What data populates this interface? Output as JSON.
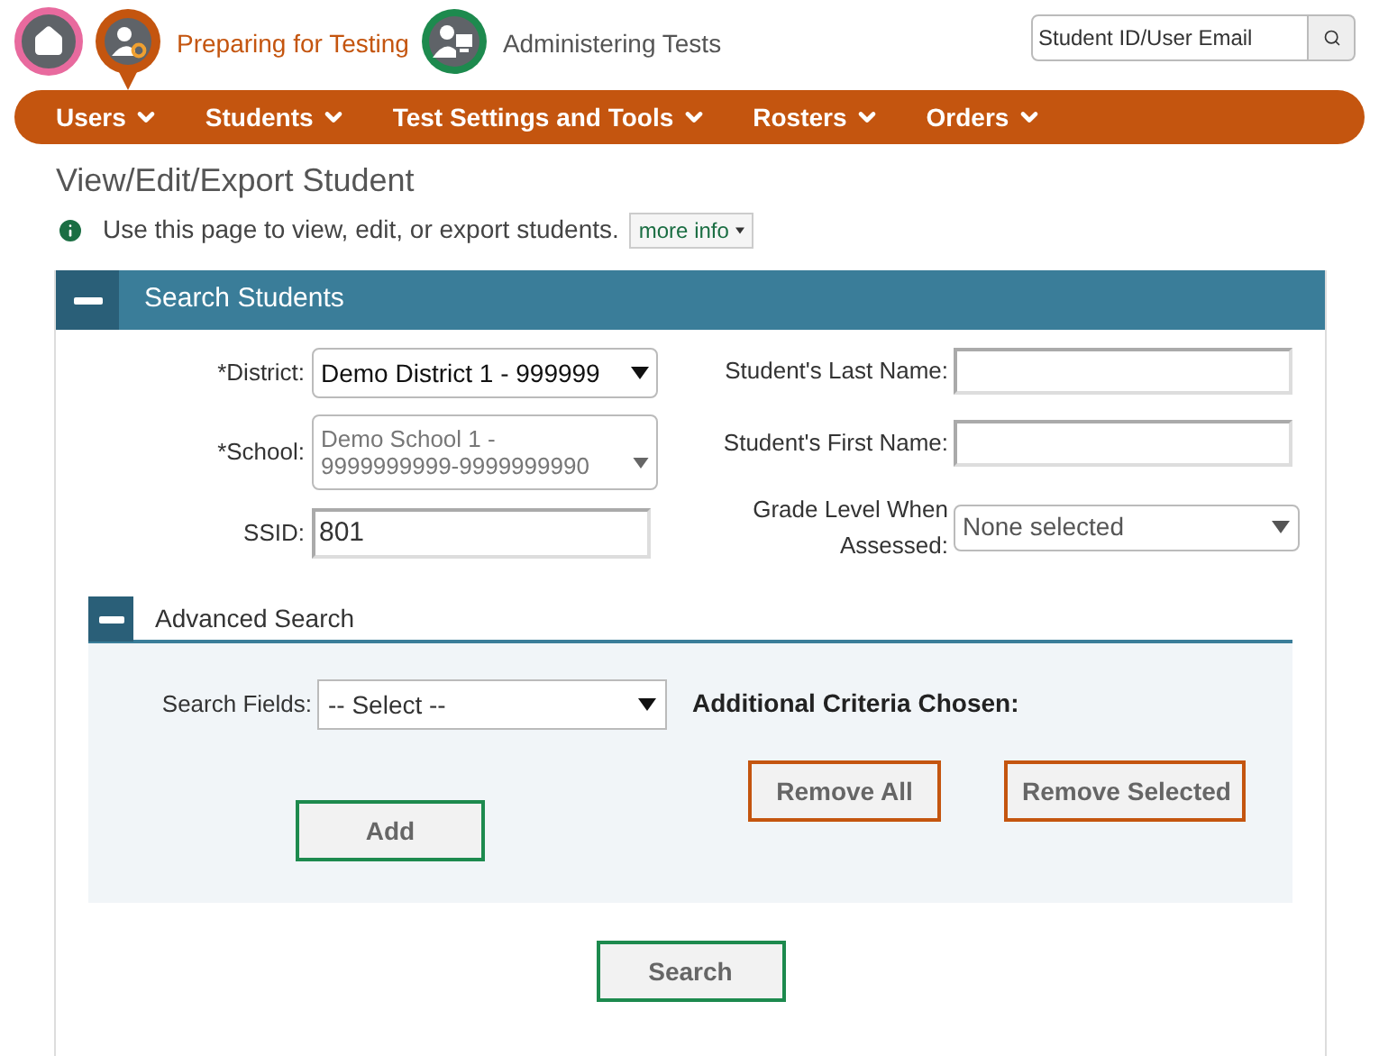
{
  "header": {
    "apps": [
      {
        "label": "Preparing for Testing",
        "selected": true,
        "kind": "preparing"
      },
      {
        "label": "Administering Tests",
        "selected": false,
        "kind": "administering"
      }
    ],
    "search": {
      "placeholder": "Student ID/User Email"
    }
  },
  "nav": [
    "Users",
    "Students",
    "Test Settings and Tools",
    "Rosters",
    "Orders"
  ],
  "page": {
    "title": "View/Edit/Export Student",
    "info": "Use this page to view, edit, or export students.",
    "more_info": "more info"
  },
  "panel": {
    "title": "Search Students",
    "expanded": true,
    "left_fields": [
      {
        "label": "*District:",
        "value": "Demo District 1 - 999999",
        "kind": "select",
        "disabled": false
      },
      {
        "label": "*School:",
        "value": "Demo School 1 - 9999999999-9999999990",
        "kind": "select",
        "disabled": true
      },
      {
        "label": "SSID:",
        "value": "801",
        "kind": "input"
      }
    ],
    "right_fields": [
      {
        "label": "Student's Last Name:",
        "kind": "input"
      },
      {
        "label": "Student's First Name:",
        "kind": "input"
      },
      {
        "label": "Grade Level When Assessed:",
        "value": "None selected",
        "kind": "multiselect"
      }
    ],
    "advanced": {
      "title": "Advanced Search",
      "expanded": true,
      "search_fields_label": "Search Fields:",
      "search_fields_value": "-- Select --",
      "criteria_title": "Additional Criteria Chosen:",
      "add": "Add",
      "remove_all": "Remove All",
      "remove_selected": "Remove Selected"
    },
    "search_button": "Search"
  }
}
